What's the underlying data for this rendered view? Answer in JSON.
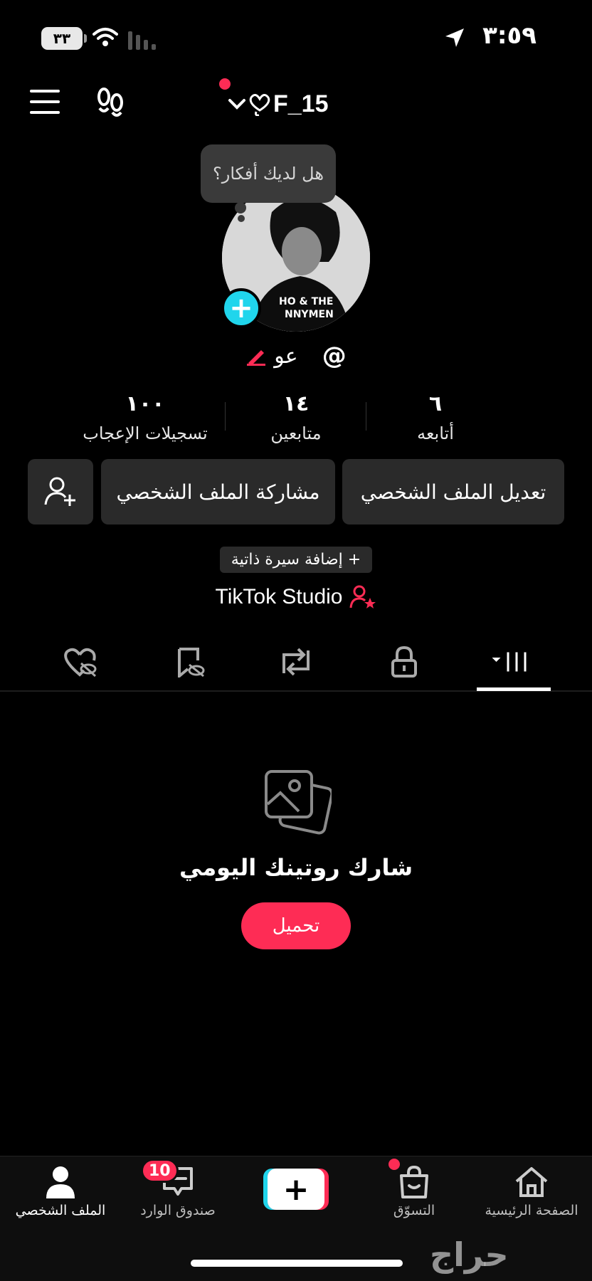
{
  "status": {
    "time": "٣:٥٩",
    "battery": "٣٣"
  },
  "header": {
    "username": "F_15"
  },
  "profile": {
    "bubble_text": "هل لديك أفكار؟",
    "handle_name": "عو",
    "handle_prefix": "@"
  },
  "stats": [
    {
      "num": "١٠٠",
      "label": "تسجيلات الإعجاب"
    },
    {
      "num": "١٤",
      "label": "متابعين"
    },
    {
      "num": "٦",
      "label": "أتابعه"
    }
  ],
  "buttons": {
    "edit_profile": "تعديل الملف الشخصي",
    "share_profile": "مشاركة الملف الشخصي",
    "add_bio": "+ إضافة سيرة ذاتية",
    "studio": "TikTok Studio"
  },
  "empty_state": {
    "title": "شارك روتينك اليومي",
    "upload": "تحميل"
  },
  "bottom_nav": {
    "profile": "الملف الشخصي",
    "inbox": "صندوق الوارد",
    "inbox_badge": "10",
    "shop": "التسوّق",
    "home": "الصفحة الرئيسية"
  },
  "watermark": "حراج",
  "colors": {
    "accent": "#fe2c55",
    "cyan": "#20d5ec",
    "background": "#000000"
  },
  "icons": [
    "menu-icon",
    "footprint-icon",
    "chevron-down-icon",
    "heart-link-icon",
    "pencil-icon",
    "add-friend-icon",
    "person-star-icon",
    "grid-tab-icon",
    "lock-icon",
    "repost-icon",
    "bookmark-hidden-icon",
    "heart-hidden-icon",
    "photos-icon",
    "profile-icon",
    "inbox-icon",
    "shop-icon",
    "home-icon"
  ]
}
